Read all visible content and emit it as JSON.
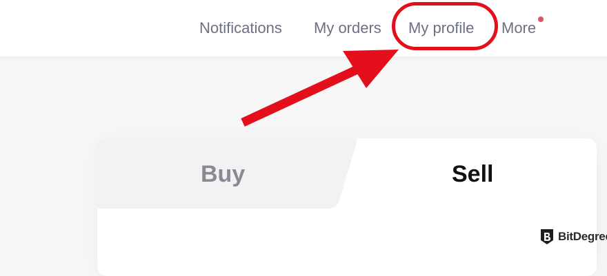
{
  "topbar": {
    "nav": {
      "notifications_label": "Notifications",
      "orders_label": "My orders",
      "profile_label": "My profile",
      "more_label": "More"
    },
    "more_badge_color": "#e0506a"
  },
  "annotation": {
    "highlight_color": "#e3101c",
    "highlight_target": "My profile"
  },
  "trade_card": {
    "tabs": [
      {
        "label": "Buy",
        "active": false
      },
      {
        "label": "Sell",
        "active": true
      }
    ]
  },
  "watermark": {
    "text": "BitDegree",
    "icon": "bitdegree-logo-icon"
  }
}
